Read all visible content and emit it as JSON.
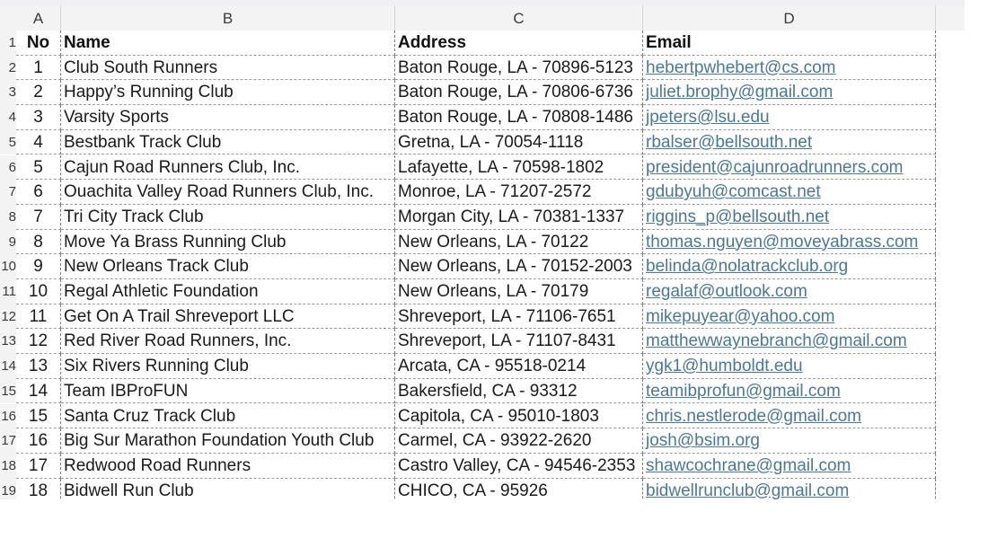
{
  "columns": [
    "A",
    "B",
    "C",
    "D"
  ],
  "header": {
    "no": "No",
    "name": "Name",
    "address": "Address",
    "email": "Email"
  },
  "row_numbers": [
    "1",
    "2",
    "3",
    "4",
    "5",
    "6",
    "7",
    "8",
    "9",
    "10",
    "11",
    "12",
    "13",
    "14",
    "15",
    "16",
    "17",
    "18",
    "19"
  ],
  "rows": [
    {
      "no": "1",
      "name": "Club South Runners",
      "address": "Baton Rouge, LA - 70896-5123",
      "email": "hebertpwhebert@cs.com"
    },
    {
      "no": "2",
      "name": "Happy’s Running Club",
      "address": "Baton Rouge, LA - 70806-6736",
      "email": "juliet.brophy@gmail.com"
    },
    {
      "no": "3",
      "name": "Varsity Sports",
      "address": "Baton Rouge, LA - 70808-1486",
      "email": "jpeters@lsu.edu"
    },
    {
      "no": "4",
      "name": "Bestbank Track Club",
      "address": "Gretna, LA - 70054-1118",
      "email": "rbalser@bellsouth.net"
    },
    {
      "no": "5",
      "name": "Cajun Road Runners Club, Inc.",
      "address": "Lafayette, LA - 70598-1802",
      "email": "president@cajunroadrunners.com"
    },
    {
      "no": "6",
      "name": "Ouachita Valley Road Runners Club, Inc.",
      "address": "Monroe, LA - 71207-2572",
      "email": "gdubyuh@comcast.net"
    },
    {
      "no": "7",
      "name": "Tri City Track Club",
      "address": "Morgan City, LA - 70381-1337",
      "email": "riggins_p@bellsouth.net"
    },
    {
      "no": "8",
      "name": "Move Ya Brass Running Club",
      "address": "New Orleans, LA - 70122",
      "email": "thomas.nguyen@moveyabrass.com"
    },
    {
      "no": "9",
      "name": "New Orleans Track Club",
      "address": "New Orleans, LA - 70152-2003",
      "email": "belinda@nolatrackclub.org"
    },
    {
      "no": "10",
      "name": "Regal Athletic Foundation",
      "address": "New Orleans, LA - 70179",
      "email": "regalaf@outlook.com"
    },
    {
      "no": "11",
      "name": "Get On A Trail Shreveport LLC",
      "address": "Shreveport, LA - 71106-7651",
      "email": "mikepuyear@yahoo.com"
    },
    {
      "no": "12",
      "name": "Red River Road Runners, Inc.",
      "address": "Shreveport, LA - 71107-8431",
      "email": "matthewwaynebranch@gmail.com"
    },
    {
      "no": "13",
      "name": "Six Rivers Running Club",
      "address": "Arcata, CA - 95518-0214",
      "email": "ygk1@humboldt.edu"
    },
    {
      "no": "14",
      "name": "Team IBProFUN",
      "address": "Bakersfield, CA - 93312",
      "email": "teamibprofun@gmail.com"
    },
    {
      "no": "15",
      "name": "Santa Cruz Track Club",
      "address": "Capitola, CA - 95010-1803",
      "email": "chris.nestlerode@gmail.com"
    },
    {
      "no": "16",
      "name": "Big Sur Marathon Foundation Youth Club",
      "address": "Carmel, CA - 93922-2620",
      "email": "josh@bsim.org"
    },
    {
      "no": "17",
      "name": "Redwood Road Runners",
      "address": "Castro Valley, CA - 94546-2353",
      "email": "shawcochrane@gmail.com"
    },
    {
      "no": "18",
      "name": "Bidwell Run Club",
      "address": "CHICO, CA - 95926",
      "email": "bidwellrunclub@gmail.com"
    }
  ],
  "colors": {
    "header_bg": "#f3f3f3",
    "link": "#4a7896",
    "grid_dash": "#7a7a7a"
  }
}
